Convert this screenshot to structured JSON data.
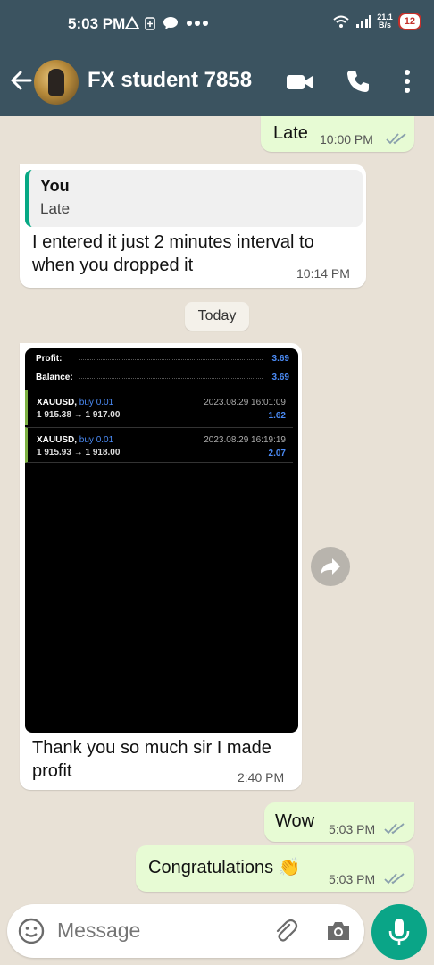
{
  "status_bar": {
    "time": "5:03 PM",
    "icons": [
      "alert-triangle-icon",
      "battery-saver-icon",
      "chat-bubble-icon",
      "more-dots-icon"
    ],
    "net_speed_top": "21.1",
    "net_speed_bottom": "B/s",
    "battery": "12"
  },
  "header": {
    "contact_name": "FX student 7858",
    "icons": [
      "back-arrow-icon",
      "video-call-icon",
      "voice-call-icon",
      "menu-dots-icon"
    ]
  },
  "messages": {
    "m1": {
      "text": "Late",
      "time": "10:00 PM"
    },
    "m2": {
      "quote_author": "You",
      "quote_text": "Late",
      "text_line1": "I entered it just 2 minutes interval to",
      "text_line2": "when you dropped it",
      "time": "10:14 PM"
    },
    "day_separator": "Today",
    "m3": {
      "image": {
        "profit_label": "Profit:",
        "profit_value": "3.69",
        "balance_label": "Balance:",
        "balance_value": "3.69",
        "trades": [
          {
            "symbol": "XAUUSD,",
            "side": "buy 0.01",
            "prices": "1 915.38 → 1 917.00",
            "date": "2023.08.29 16:01:09",
            "pl": "1.62"
          },
          {
            "symbol": "XAUUSD,",
            "side": "buy 0.01",
            "prices": "1 915.93 → 1 918.00",
            "date": "2023.08.29 16:19:19",
            "pl": "2.07"
          }
        ]
      },
      "text_line1": "Thank you so much sir I made",
      "text_line2": "profit",
      "time": "2:40 PM"
    },
    "m4": {
      "text": "Wow",
      "time": "5:03 PM"
    },
    "m5": {
      "text": "Congratulations 👏",
      "time": "5:03 PM"
    }
  },
  "composer": {
    "placeholder": "Message",
    "icons": [
      "emoji-icon",
      "attach-icon",
      "camera-icon",
      "mic-icon"
    ]
  },
  "colors": {
    "appbar": "#3b5360",
    "outgoing_bubble": "#e7fbd4",
    "incoming_bubble": "#ffffff",
    "accent": "#0aa587",
    "read_ticks": "#8aa0ad"
  }
}
